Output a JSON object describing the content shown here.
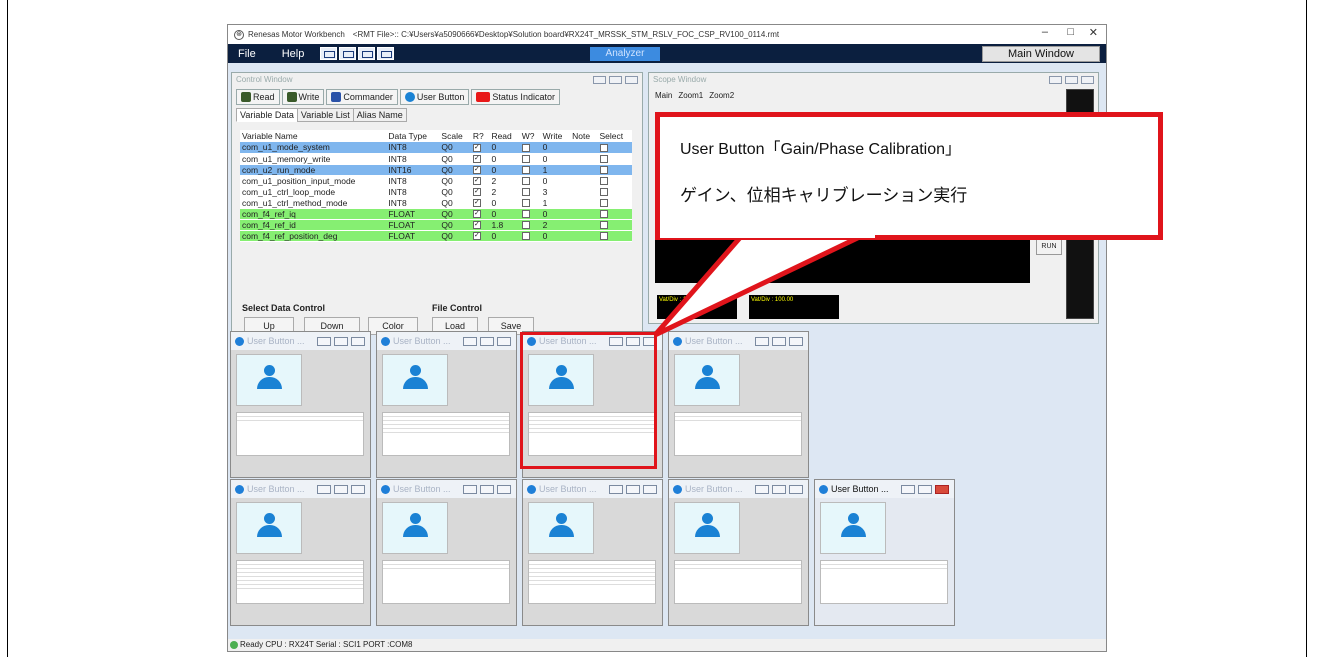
{
  "window": {
    "title": "Renesas Motor Workbench　<RMT File>:: C:¥Users¥a5090666¥Desktop¥Solution board¥RX24T_MRSSK_STM_RSLV_FOC_CSP_RV100_0114.rmt",
    "minimize": "–",
    "maximize": "□",
    "close": "✕"
  },
  "menu": {
    "file": "File",
    "help": "Help",
    "analyzer": "Analyzer",
    "main_window": "Main Window"
  },
  "control": {
    "title": "Control Window",
    "toolbar": {
      "read": "Read",
      "write": "Write",
      "commander": "Commander",
      "user_button": "User Button",
      "status": "Status Indicator"
    },
    "tabs": [
      "Variable Data",
      "Variable List",
      "Alias Name"
    ],
    "headers": [
      "Variable Name",
      "Data Type",
      "Scale",
      "R?",
      "Read",
      "W?",
      "Write",
      "Note",
      "Select"
    ],
    "rows": [
      {
        "name": "com_u1_mode_system",
        "type": "INT8",
        "scale": "Q0",
        "read": "0",
        "write": "0",
        "color": "#7fb6ee"
      },
      {
        "name": "com_u1_memory_write",
        "type": "INT8",
        "scale": "Q0",
        "read": "0",
        "write": "0",
        "color": "#ffffff"
      },
      {
        "name": "com_u2_run_mode",
        "type": "INT16",
        "scale": "Q0",
        "read": "0",
        "write": "1",
        "color": "#7fb6ee"
      },
      {
        "name": "com_u1_position_input_mode",
        "type": "INT8",
        "scale": "Q0",
        "read": "2",
        "write": "0",
        "color": "#ffffff"
      },
      {
        "name": "com_u1_ctrl_loop_mode",
        "type": "INT8",
        "scale": "Q0",
        "read": "2",
        "write": "3",
        "color": "#ffffff"
      },
      {
        "name": "com_u1_ctrl_method_mode",
        "type": "INT8",
        "scale": "Q0",
        "read": "0",
        "write": "1",
        "color": "#ffffff"
      },
      {
        "name": "com_f4_ref_iq",
        "type": "FLOAT",
        "scale": "Q0",
        "read": "0",
        "write": "0",
        "color": "#86ef72"
      },
      {
        "name": "com_f4_ref_id",
        "type": "FLOAT",
        "scale": "Q0",
        "read": "1.8",
        "write": "2",
        "color": "#86ef72"
      },
      {
        "name": "com_f4_ref_position_deg",
        "type": "FLOAT",
        "scale": "Q0",
        "read": "0",
        "write": "0",
        "color": "#86ef72"
      }
    ],
    "select_data_control": "Select Data Control",
    "file_control": "File Control",
    "btn_up": "Up",
    "btn_down": "Down",
    "btn_color": "Color",
    "btn_load": "Load",
    "btn_save": "Save"
  },
  "scope": {
    "title": "Scope Window",
    "tabs": [
      "Main",
      "Zoom1",
      "Zoom2"
    ],
    "run": "RUN",
    "vdiv": "Vat/Div : 100.00"
  },
  "user_button_title": "User Button ...",
  "callout": {
    "line1": "User Button「Gain/Phase Calibration」",
    "line2": "ゲイン、位相キャリブレーション実行"
  },
  "status": "Ready  CPU : RX24T Serial : SCI1  PORT :COM8"
}
